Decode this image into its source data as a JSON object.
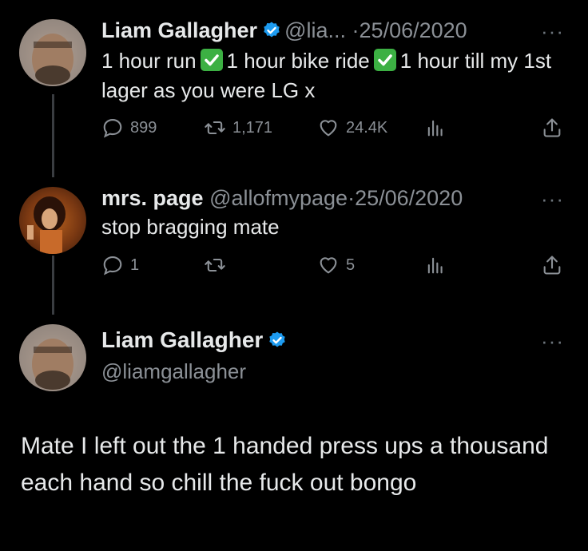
{
  "tweets": [
    {
      "name": "Liam Gallagher",
      "handle": "@lia...",
      "separator": "·",
      "date": "25/06/2020",
      "text_parts": [
        "1 hour run",
        "1 hour bike ride",
        "1 hour till my 1st lager as you were LG x"
      ],
      "replies": "899",
      "retweets": "1,171",
      "likes": "24.4K",
      "more": "···"
    },
    {
      "name": "mrs. page",
      "handle": "@allofmypage",
      "separator": "·",
      "date": "25/06/2020",
      "text": "stop bragging mate",
      "replies": "1",
      "retweets": "",
      "likes": "5",
      "more": "···"
    }
  ],
  "main_tweet": {
    "name": "Liam Gallagher",
    "handle": "@liamgallagher",
    "text": "Mate I left out the 1 handed press ups a thousand each hand so chill the fuck out bongo",
    "more": "···"
  },
  "icons": {
    "verified": "verified-badge-icon",
    "check": "check-mark-emoji",
    "reply": "reply-icon",
    "retweet": "retweet-icon",
    "like": "like-icon",
    "views": "views-icon",
    "share": "share-icon"
  },
  "colors": {
    "background": "#000000",
    "verified": "#1d9bf0",
    "check": "#3cb043",
    "secondary_text": "#8b9096"
  }
}
